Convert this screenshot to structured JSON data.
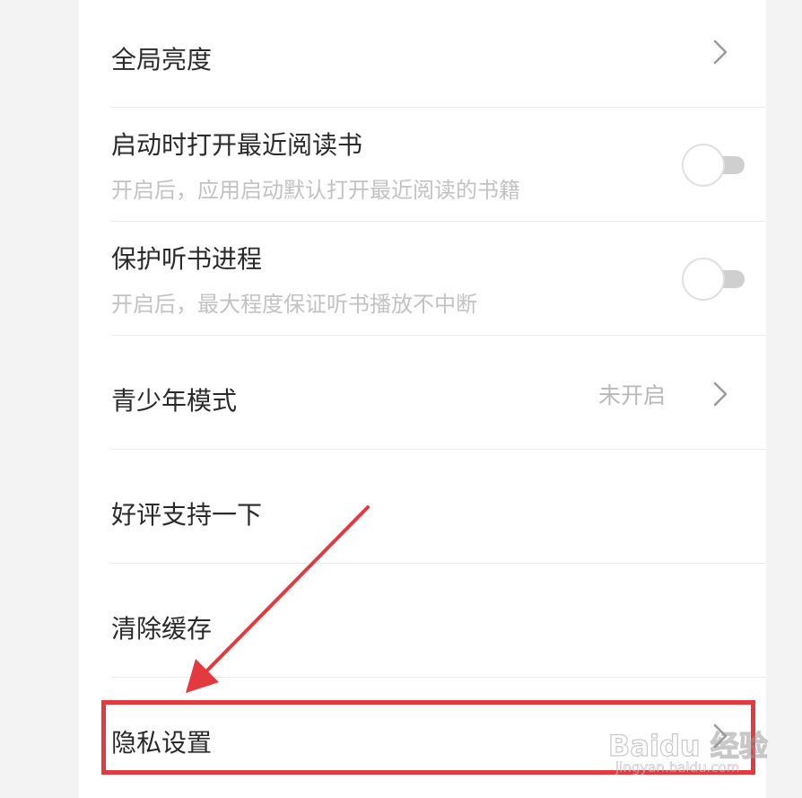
{
  "settings": {
    "items": [
      {
        "title": "全局亮度",
        "control": "chevron"
      },
      {
        "title": "启动时打开最近阅读书",
        "subtitle": "开启后，应用启动默认打开最近阅读的书籍",
        "control": "toggle",
        "enabled": false
      },
      {
        "title": "保护听书进程",
        "subtitle": "开启后，最大程度保证听书播放不中断",
        "control": "toggle",
        "enabled": false
      },
      {
        "title": "青少年模式",
        "value": "未开启",
        "control": "chevron"
      },
      {
        "title": "好评支持一下",
        "control": "none"
      },
      {
        "title": "清除缓存",
        "control": "none"
      },
      {
        "title": "隐私设置",
        "control": "chevron"
      }
    ]
  },
  "annotation": {
    "highlight_color": "#e23a3f",
    "arrow_color": "#e23a3f"
  },
  "watermark": {
    "logo": "Baidu 经验",
    "url": "jingyan.baidu.com"
  },
  "colors": {
    "title": "#2a2a2a",
    "subtitle": "#c2c2c2",
    "chevron": "#9a9a9a",
    "toggle_track": "#cfcfcf"
  },
  "icons": [
    "chevron-right-icon",
    "toggle-switch"
  ]
}
